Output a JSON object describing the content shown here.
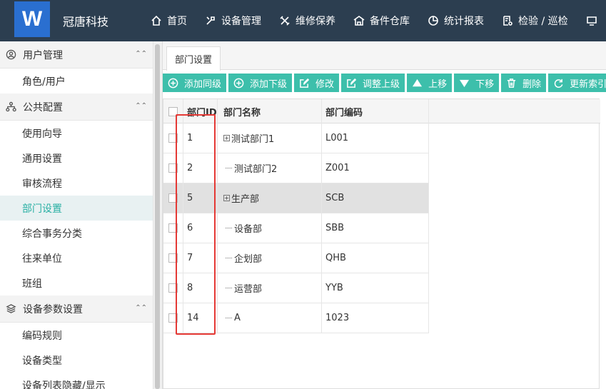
{
  "app": {
    "logo_letter": "W",
    "brand": "冠唐科技"
  },
  "nav": [
    {
      "label": "首页",
      "icon": "home-icon"
    },
    {
      "label": "设备管理",
      "icon": "tools-icon"
    },
    {
      "label": "维修保养",
      "icon": "wrench-icon"
    },
    {
      "label": "备件仓库",
      "icon": "warehouse-icon"
    },
    {
      "label": "统计报表",
      "icon": "pie-chart-icon"
    },
    {
      "label": "检验 / 巡检",
      "icon": "inspect-icon"
    }
  ],
  "sidebar": {
    "groups": [
      {
        "label": "用户管理",
        "icon": "user-circle-icon",
        "items": [
          "角色/用户"
        ]
      },
      {
        "label": "公共配置",
        "icon": "org-chart-icon",
        "items": [
          "使用向导",
          "通用设置",
          "审核流程",
          "部门设置",
          "综合事务分类",
          "往来单位",
          "班组"
        ]
      },
      {
        "label": "设备参数设置",
        "icon": "layers-icon",
        "items": [
          "编码规则",
          "设备类型",
          "设备列表隐藏/显示"
        ]
      }
    ],
    "active_item": "部门设置"
  },
  "tab": {
    "label": "部门设置"
  },
  "toolbar": [
    {
      "label": "添加同级",
      "icon": "plus-circle-icon"
    },
    {
      "label": "添加下级",
      "icon": "plus-circle-icon"
    },
    {
      "label": "修改",
      "icon": "edit-icon"
    },
    {
      "label": "调整上级",
      "icon": "edit-icon"
    },
    {
      "label": "上移",
      "icon": "arrow-up-icon"
    },
    {
      "label": "下移",
      "icon": "arrow-down-icon"
    },
    {
      "label": "删除",
      "icon": "trash-icon"
    },
    {
      "label": "更新索引",
      "icon": "refresh-icon"
    }
  ],
  "grid": {
    "headers": {
      "id": "部门ID",
      "name": "部门名称",
      "code": "部门编码"
    },
    "rows": [
      {
        "id": "1",
        "name": "测试部门1",
        "code": "L001",
        "expandable": true
      },
      {
        "id": "2",
        "name": "测试部门2",
        "code": "Z001",
        "expandable": false
      },
      {
        "id": "5",
        "name": "生产部",
        "code": "SCB",
        "expandable": true,
        "highlighted": true
      },
      {
        "id": "6",
        "name": "设备部",
        "code": "SBB",
        "expandable": false
      },
      {
        "id": "7",
        "name": "企划部",
        "code": "QHB",
        "expandable": false
      },
      {
        "id": "8",
        "name": "运营部",
        "code": "YYB",
        "expandable": false
      },
      {
        "id": "14",
        "name": "A",
        "code": "1023",
        "expandable": false
      }
    ]
  },
  "colors": {
    "header_bg": "#2c3e50",
    "accent": "#3dbfab",
    "active_text": "#2ab0a4",
    "highlight_box": "#e53935"
  }
}
